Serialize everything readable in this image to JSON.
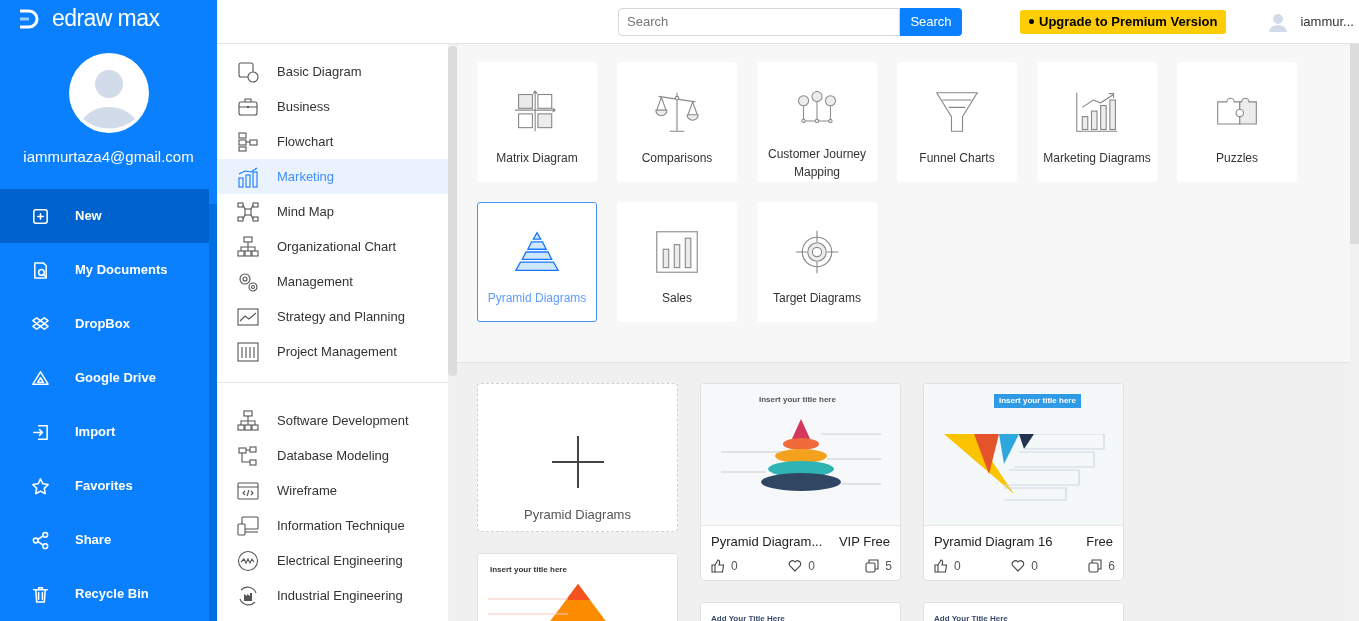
{
  "app": {
    "logo": "edraw max"
  },
  "user": {
    "email": "iammurtaza4@gmail.com"
  },
  "nav": [
    {
      "label": "New",
      "selected": true
    },
    {
      "label": "My Documents",
      "selected": false
    },
    {
      "label": "DropBox",
      "selected": false
    },
    {
      "label": "Google Drive",
      "selected": false
    },
    {
      "label": "Import",
      "selected": false
    },
    {
      "label": "Favorites",
      "selected": false
    },
    {
      "label": "Share",
      "selected": false
    },
    {
      "label": "Recycle Bin",
      "selected": false
    }
  ],
  "topbar": {
    "search": {
      "placeholder": "Search",
      "button": "Search"
    },
    "upgrade": "Upgrade to Premium Version",
    "username": "iammur..."
  },
  "categories": [
    [
      {
        "label": "Basic Diagram",
        "selected": false
      },
      {
        "label": "Business",
        "selected": false
      },
      {
        "label": "Flowchart",
        "selected": false
      },
      {
        "label": "Marketing",
        "selected": true
      },
      {
        "label": "Mind Map",
        "selected": false
      },
      {
        "label": "Organizational Chart",
        "selected": false
      },
      {
        "label": "Management",
        "selected": false
      },
      {
        "label": "Strategy and Planning",
        "selected": false
      },
      {
        "label": "Project Management",
        "selected": false
      }
    ],
    [
      {
        "label": "Software Development",
        "selected": false
      },
      {
        "label": "Database Modeling",
        "selected": false
      },
      {
        "label": "Wireframe",
        "selected": false
      },
      {
        "label": "Information Technique",
        "selected": false
      },
      {
        "label": "Electrical Engineering",
        "selected": false
      },
      {
        "label": "Industrial Engineering",
        "selected": false
      }
    ]
  ],
  "tiles": [
    {
      "label": "Matrix Diagram",
      "selected": false
    },
    {
      "label": "Comparisons",
      "selected": false
    },
    {
      "label": "Customer Journey Mapping",
      "selected": false
    },
    {
      "label": "Funnel Charts",
      "selected": false
    },
    {
      "label": "Marketing Diagrams",
      "selected": false
    },
    {
      "label": "Puzzles",
      "selected": false
    },
    {
      "label": "Pyramid Diagrams",
      "selected": true
    },
    {
      "label": "Sales",
      "selected": false
    },
    {
      "label": "Target Diagrams",
      "selected": false
    }
  ],
  "template_columns": [
    [
      {
        "kind": "blank",
        "label": "Pyramid Diagrams"
      },
      {
        "kind": "triangle",
        "preview_title": "Insert your title here"
      }
    ],
    [
      {
        "kind": "stack",
        "preview_title": "Insert your title here",
        "name": "Pyramid Diagram...",
        "price": "VIP Free",
        "likes": "0",
        "favorites": "0",
        "copies": "5"
      },
      {
        "kind": "plain",
        "preview_title": "Add Your Title Here"
      }
    ],
    [
      {
        "kind": "inverted",
        "preview_title": "Insert your title here",
        "name": "Pyramid Diagram 16",
        "price": "Free",
        "likes": "0",
        "favorites": "0",
        "copies": "6"
      },
      {
        "kind": "plain",
        "preview_title": "Add Your Title Here"
      }
    ]
  ]
}
